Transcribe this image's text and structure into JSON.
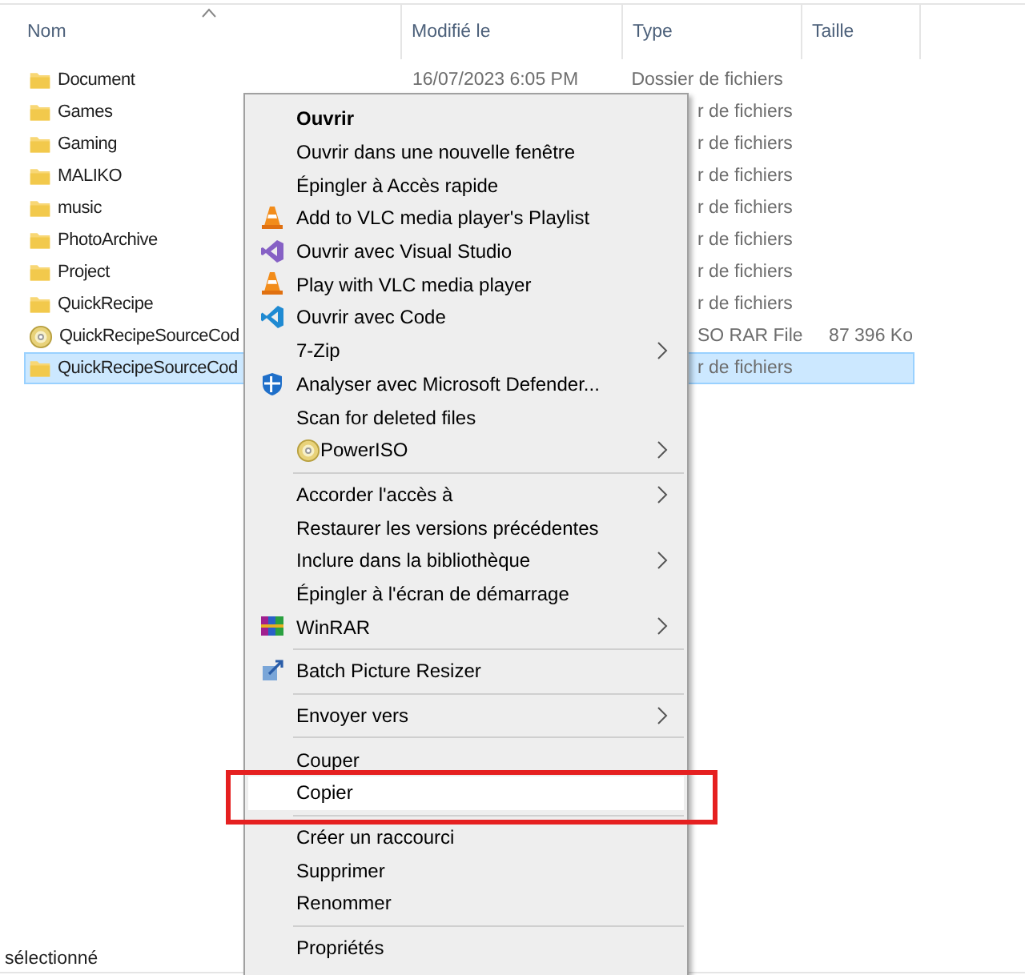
{
  "columns": [
    {
      "label": "Nom"
    },
    {
      "label": "Modifié le"
    },
    {
      "label": "Type"
    },
    {
      "label": "Taille"
    }
  ],
  "files": [
    {
      "name": "Document",
      "kind": "folder",
      "modified": "16/07/2023 6:05 PM",
      "type": "Dossier de fichiers",
      "selected": false
    },
    {
      "name": "Games",
      "kind": "folder",
      "type": "r de fichiers",
      "selected": false
    },
    {
      "name": "Gaming",
      "kind": "folder",
      "type": "r de fichiers",
      "selected": false
    },
    {
      "name": "MALIKO",
      "kind": "folder",
      "type": "r de fichiers",
      "selected": false
    },
    {
      "name": "music",
      "kind": "folder",
      "type": "r de fichiers",
      "selected": false
    },
    {
      "name": "PhotoArchive",
      "kind": "folder",
      "type": "r de fichiers",
      "selected": false
    },
    {
      "name": "Project",
      "kind": "folder",
      "type": "r de fichiers",
      "selected": false
    },
    {
      "name": "QuickRecipe",
      "kind": "folder",
      "type": "r de fichiers",
      "selected": false
    },
    {
      "name": "QuickRecipeSourceCod",
      "kind": "disc",
      "type": "SO RAR File",
      "size": "87 396 Ko",
      "selected": false
    },
    {
      "name": "QuickRecipeSourceCod",
      "kind": "folder",
      "type": "r de fichiers",
      "selected": true
    }
  ],
  "context_menu": [
    {
      "kind": "item",
      "label": "Ouvrir",
      "default": true,
      "selected": false
    },
    {
      "kind": "item",
      "label": "Ouvrir dans une nouvelle fenêtre",
      "selected": false
    },
    {
      "kind": "item",
      "label": "Épingler à Accès rapide",
      "selected": false
    },
    {
      "kind": "cone",
      "label": "Add to VLC media player's Playlist",
      "selected": false
    },
    {
      "kind": "ribbon",
      "label": "Ouvrir avec Visual Studio",
      "selected": false
    },
    {
      "kind": "cone",
      "label": "Play with VLC media player",
      "selected": false
    },
    {
      "kind": "angle",
      "label": "Ouvrir avec Code",
      "selected": false
    },
    {
      "kind": "item",
      "label": "7-Zip",
      "submenu": true,
      "selected": false
    },
    {
      "kind": "shield",
      "label": "Analyser avec Microsoft Defender...",
      "selected": false
    },
    {
      "kind": "item",
      "label": "Scan for deleted files",
      "selected": false
    },
    {
      "kind": "disc",
      "label": "PowerISO",
      "submenu": true,
      "selected": false
    },
    {
      "kind": "separator"
    },
    {
      "kind": "item",
      "label": "Accorder l'accès à",
      "submenu": true,
      "selected": false
    },
    {
      "kind": "item",
      "label": "Restaurer les versions précédentes",
      "selected": false
    },
    {
      "kind": "item",
      "label": "Inclure dans la bibliothèque",
      "submenu": true,
      "selected": false
    },
    {
      "kind": "item",
      "label": "Épingler à l'écran de démarrage",
      "selected": false
    },
    {
      "kind": "books",
      "label": "WinRAR",
      "submenu": true,
      "selected": false
    },
    {
      "kind": "separator"
    },
    {
      "kind": "resize",
      "label": "Batch Picture Resizer",
      "selected": false
    },
    {
      "kind": "separator"
    },
    {
      "kind": "item",
      "label": "Envoyer vers",
      "submenu": true,
      "selected": false
    },
    {
      "kind": "separator"
    },
    {
      "kind": "item",
      "label": "Couper",
      "selected": false
    },
    {
      "kind": "item",
      "label": "Copier",
      "selected": true,
      "marked": true
    },
    {
      "kind": "separator"
    },
    {
      "kind": "item",
      "label": "Créer un raccourci",
      "selected": false
    },
    {
      "kind": "item",
      "label": "Supprimer",
      "selected": false
    },
    {
      "kind": "item",
      "label": "Renommer",
      "selected": false
    },
    {
      "kind": "separator"
    },
    {
      "kind": "item",
      "label": "Propriétés",
      "selected": false
    }
  ],
  "status_bar": {
    "text": "sélectionné"
  }
}
